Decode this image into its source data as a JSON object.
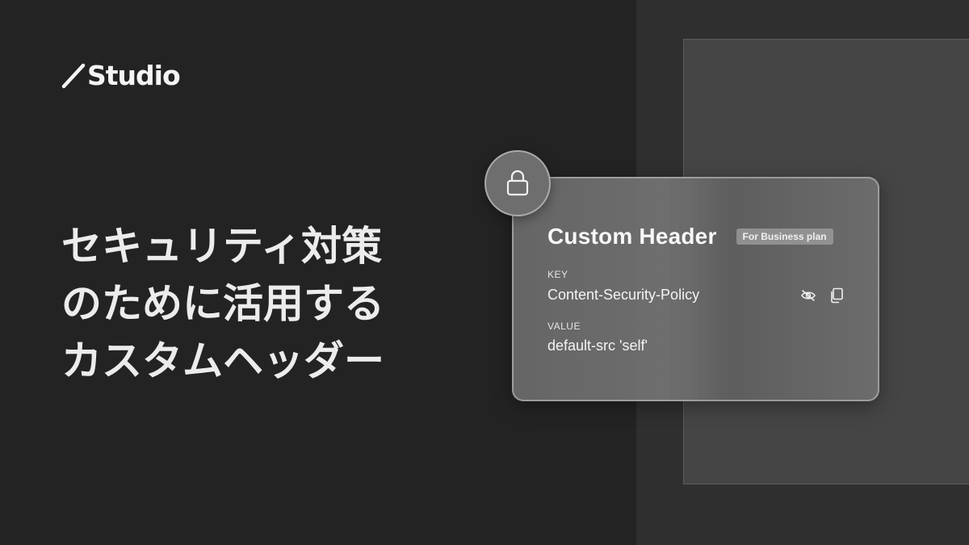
{
  "brand": {
    "logo_text": "Studio"
  },
  "headline": {
    "lines": [
      "セキュリティ対策",
      "のために活用する",
      "カスタムヘッダー"
    ]
  },
  "card": {
    "title": "Custom Header",
    "badge": "For Business plan",
    "key_label": "KEY",
    "key_value": "Content-Security-Policy",
    "value_label": "VALUE",
    "value_value": "default-src 'self'"
  },
  "icons": {
    "lock": "lock-icon",
    "visibility": "eye-off-icon",
    "copy": "copy-icon",
    "logo_mark": "slash-icon"
  },
  "colors": {
    "background": "#232323",
    "right_panel": "#2f2f2f",
    "card": "#707070",
    "text": "#f2f2f2"
  }
}
